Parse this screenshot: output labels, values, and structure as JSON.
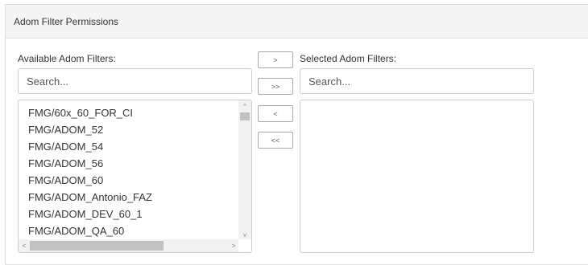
{
  "panel": {
    "title": "Adom Filter Permissions"
  },
  "available": {
    "label": "Available Adom Filters:",
    "search_placeholder": "Search...",
    "items": [
      "FMG/60x_60_FOR_CI",
      "FMG/ADOM_52",
      "FMG/ADOM_54",
      "FMG/ADOM_56",
      "FMG/ADOM_60",
      "FMG/ADOM_Antonio_FAZ",
      "FMG/ADOM_DEV_60_1",
      "FMG/ADOM_QA_60"
    ]
  },
  "selected": {
    "label": "Selected Adom Filters:",
    "search_placeholder": "Search...",
    "items": []
  },
  "buttons": {
    "add_one": ">",
    "add_all": ">>",
    "remove_one": "<",
    "remove_all": "<<"
  },
  "scroll": {
    "up": "^",
    "down": "v",
    "left": "<",
    "right": ">"
  }
}
